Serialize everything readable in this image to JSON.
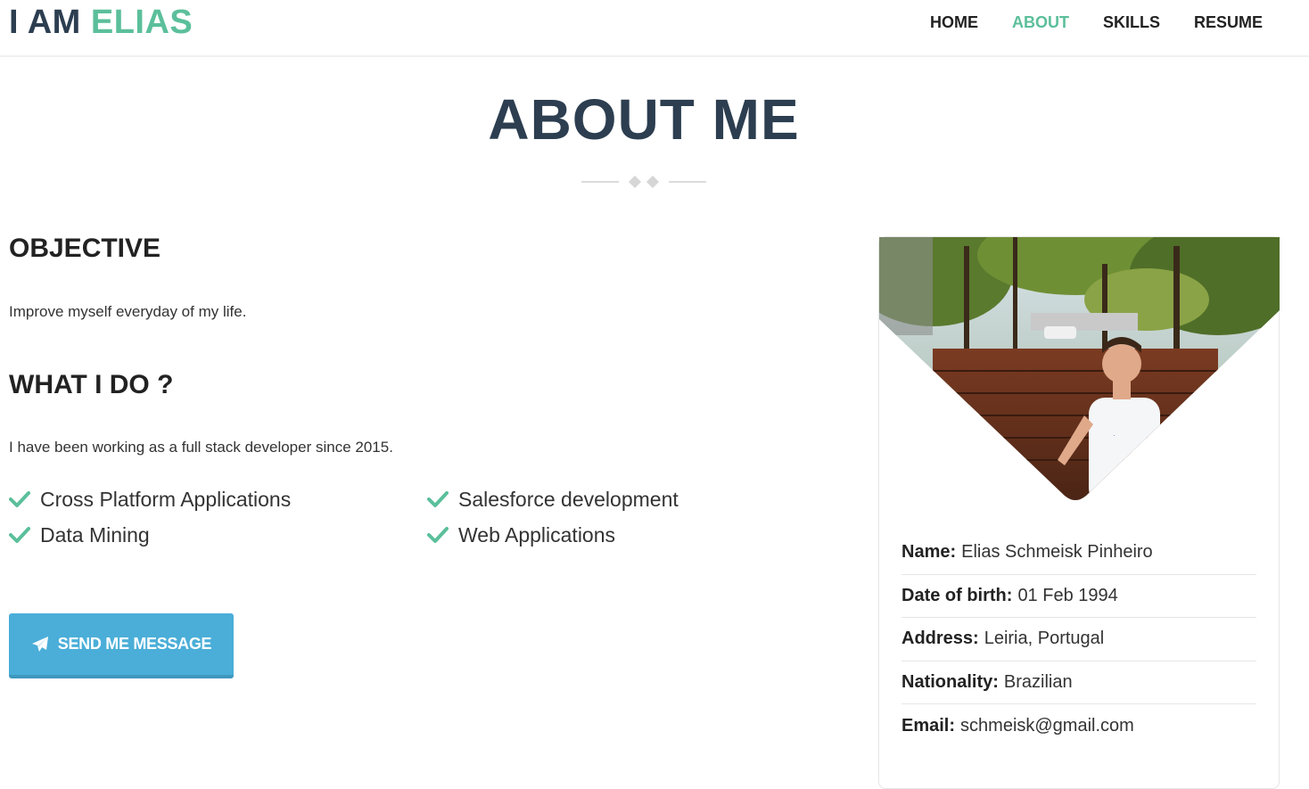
{
  "brand": {
    "prefix": "I AM",
    "name": "ELIAS"
  },
  "nav": {
    "items": [
      {
        "label": "HOME",
        "active": false
      },
      {
        "label": "ABOUT",
        "active": true
      },
      {
        "label": "SKILLS",
        "active": false
      },
      {
        "label": "RESUME",
        "active": false
      }
    ]
  },
  "page": {
    "title": "ABOUT ME"
  },
  "objective": {
    "heading": "OBJECTIVE",
    "text": "Improve myself everyday of my life."
  },
  "what_i_do": {
    "heading": "WHAT I DO ?",
    "text": "I have been working as a full stack developer since 2015.",
    "skills": [
      "Cross Platform Applications",
      "Salesforce development",
      "Data Mining",
      "Web Applications"
    ]
  },
  "cta": {
    "label": "SEND ME MESSAGE",
    "icon": "paper-plane-icon"
  },
  "profile": {
    "photo_alt": "profile-photo",
    "rows": [
      {
        "key": "Name:",
        "value": "Elias Schmeisk Pinheiro"
      },
      {
        "key": "Date of birth:",
        "value": "01 Feb 1994"
      },
      {
        "key": "Address:",
        "value": "Leiria, Portugal"
      },
      {
        "key": "Nationality:",
        "value": "Brazilian"
      },
      {
        "key": "Email:",
        "value": "schmeisk@gmail.com"
      }
    ]
  },
  "colors": {
    "accent": "#5bbf9b",
    "heading": "#2c3e50",
    "button": "#4aaed8"
  }
}
